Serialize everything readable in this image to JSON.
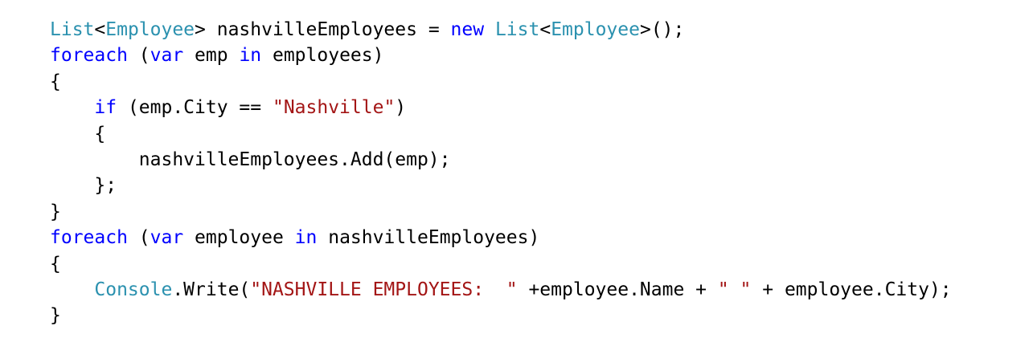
{
  "colors": {
    "keyword": "#0000ff",
    "type": "#2b91af",
    "string": "#a31515",
    "plain": "#000000",
    "background": "#ffffff"
  },
  "code_lines": [
    [
      {
        "t": "List",
        "k": "type"
      },
      {
        "t": "<",
        "k": "plain"
      },
      {
        "t": "Employee",
        "k": "type"
      },
      {
        "t": "> nashvilleEmployees = ",
        "k": "plain"
      },
      {
        "t": "new",
        "k": "kw"
      },
      {
        "t": " ",
        "k": "plain"
      },
      {
        "t": "List",
        "k": "type"
      },
      {
        "t": "<",
        "k": "plain"
      },
      {
        "t": "Employee",
        "k": "type"
      },
      {
        "t": ">();",
        "k": "plain"
      }
    ],
    [
      {
        "t": "foreach",
        "k": "kw"
      },
      {
        "t": " (",
        "k": "plain"
      },
      {
        "t": "var",
        "k": "kw"
      },
      {
        "t": " emp ",
        "k": "plain"
      },
      {
        "t": "in",
        "k": "kw"
      },
      {
        "t": " employees)",
        "k": "plain"
      }
    ],
    [
      {
        "t": "{",
        "k": "plain"
      }
    ],
    [
      {
        "t": "    ",
        "k": "plain"
      },
      {
        "t": "if",
        "k": "kw"
      },
      {
        "t": " (emp.City == ",
        "k": "plain"
      },
      {
        "t": "\"Nashville\"",
        "k": "str"
      },
      {
        "t": ")",
        "k": "plain"
      }
    ],
    [
      {
        "t": "    {",
        "k": "plain"
      }
    ],
    [
      {
        "t": "        nashvilleEmployees.Add(emp);",
        "k": "plain"
      }
    ],
    [
      {
        "t": "    };",
        "k": "plain"
      }
    ],
    [
      {
        "t": "}",
        "k": "plain"
      }
    ],
    [
      {
        "t": "foreach",
        "k": "kw"
      },
      {
        "t": " (",
        "k": "plain"
      },
      {
        "t": "var",
        "k": "kw"
      },
      {
        "t": " employee ",
        "k": "plain"
      },
      {
        "t": "in",
        "k": "kw"
      },
      {
        "t": " nashvilleEmployees)",
        "k": "plain"
      }
    ],
    [
      {
        "t": "{",
        "k": "plain"
      }
    ],
    [
      {
        "t": "    ",
        "k": "plain"
      },
      {
        "t": "Console",
        "k": "type"
      },
      {
        "t": ".Write(",
        "k": "plain"
      },
      {
        "t": "\"NASHVILLE EMPLOYEES:  \"",
        "k": "str"
      },
      {
        "t": " +employee.Name + ",
        "k": "plain"
      },
      {
        "t": "\" \"",
        "k": "str"
      },
      {
        "t": " + employee.City);",
        "k": "plain"
      }
    ],
    [
      {
        "t": "}",
        "k": "plain"
      }
    ]
  ]
}
